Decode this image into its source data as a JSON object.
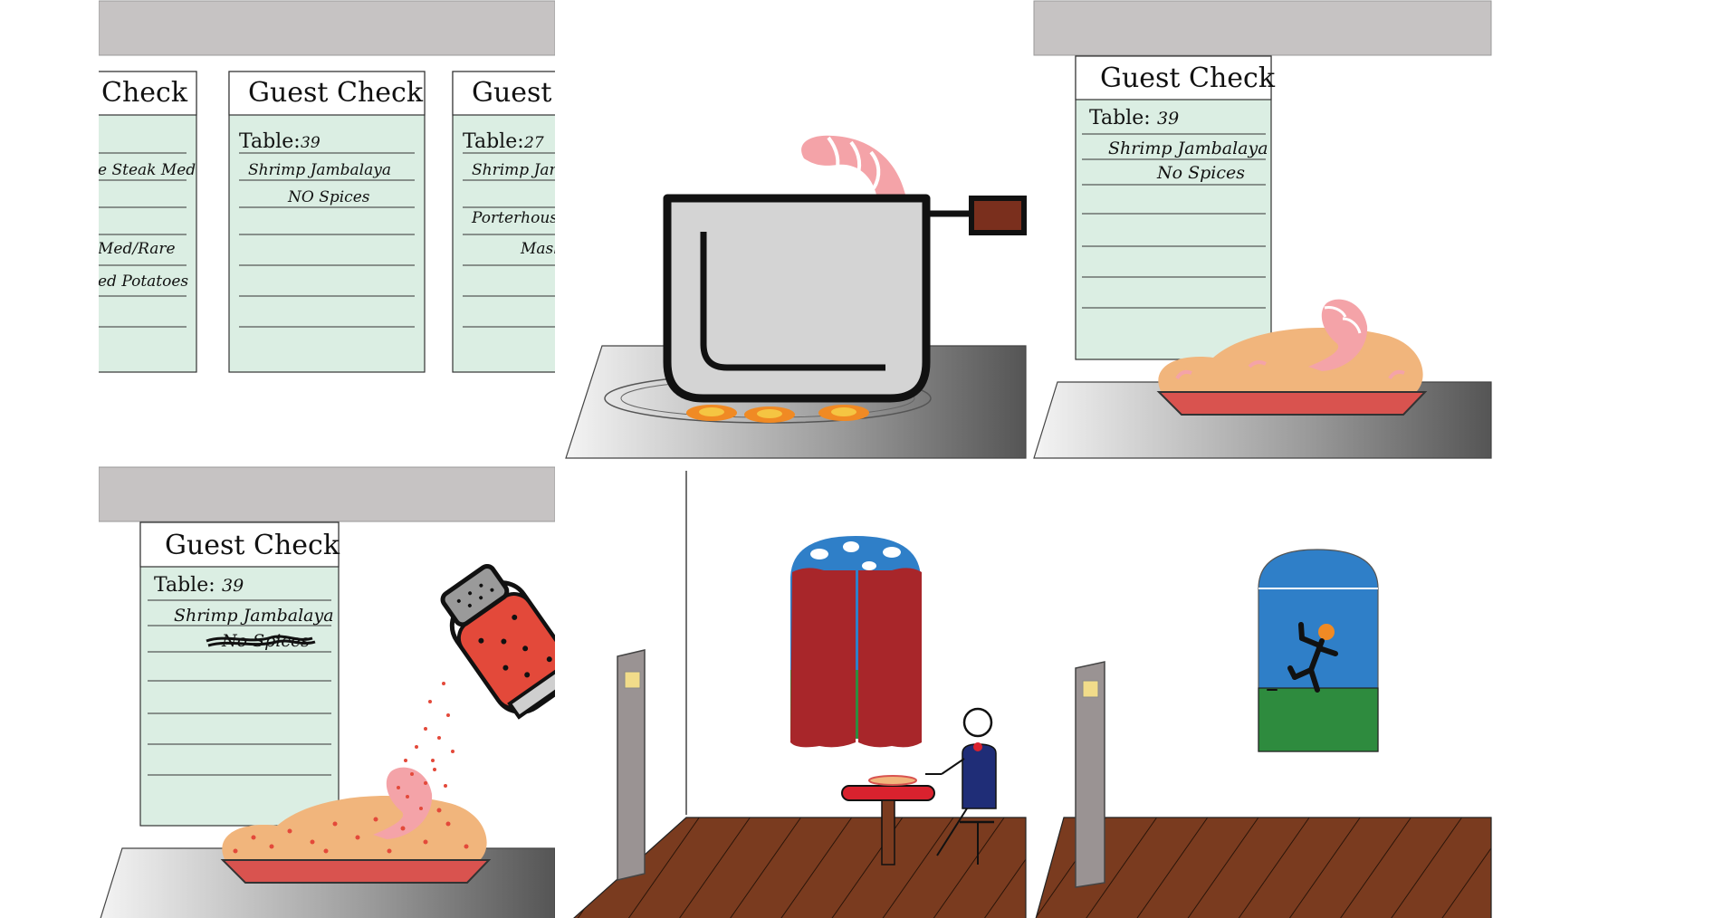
{
  "comic": {
    "colors": {
      "ticket": "#dbeee3",
      "rail": "#c6c3c3",
      "shrimp": "#f4a3a8",
      "rice": "#f1b57c",
      "plate": "#d9534f",
      "pot": "#d4d4d4",
      "handle": "#7a2f1d",
      "curtain": "#a8262a",
      "sky": "#2f7fc8",
      "grass": "#2e8b3e",
      "floor": "#7a3b1f",
      "shirt": "#1f2d77"
    },
    "panels": [
      {
        "id": "ticket-rail",
        "tickets": [
          {
            "title": "Check",
            "table": "",
            "lines": [
              "",
              "e Steak Med",
              "",
              "",
              "Med/Rare",
              "ed Potatoes",
              ""
            ]
          },
          {
            "title": "Guest Check",
            "table_label": "Table:",
            "table": "39",
            "lines": [
              "Shrimp Jambalaya",
              "NO Spices"
            ]
          },
          {
            "title": "Guest C",
            "table_label": "Table:",
            "table": "27",
            "lines": [
              "Shrimp Jamb",
              "",
              "Porterhouse S",
              "Mash"
            ]
          }
        ]
      },
      {
        "id": "cooking-pot",
        "icons": [
          "pot-icon",
          "shrimp-icon",
          "flame-icon"
        ]
      },
      {
        "id": "plated-dish",
        "ticket": {
          "title": "Guest Check",
          "table_label": "Table:",
          "table": "39",
          "lines": [
            "Shrimp Jambalaya",
            "No Spices"
          ]
        }
      },
      {
        "id": "spiced-dish",
        "ticket": {
          "title": "Guest Check",
          "table_label": "Table:",
          "table": "39",
          "lines": [
            "Shrimp Jambalaya",
            "No Spices"
          ]
        },
        "icons": [
          "pepper-shaker-icon"
        ]
      },
      {
        "id": "diner-room",
        "icons": [
          "door-icon",
          "window-icon",
          "table-icon",
          "diner-icon"
        ]
      },
      {
        "id": "empty-room",
        "icons": [
          "door-icon",
          "window-icon",
          "running-person-icon"
        ]
      }
    ]
  }
}
